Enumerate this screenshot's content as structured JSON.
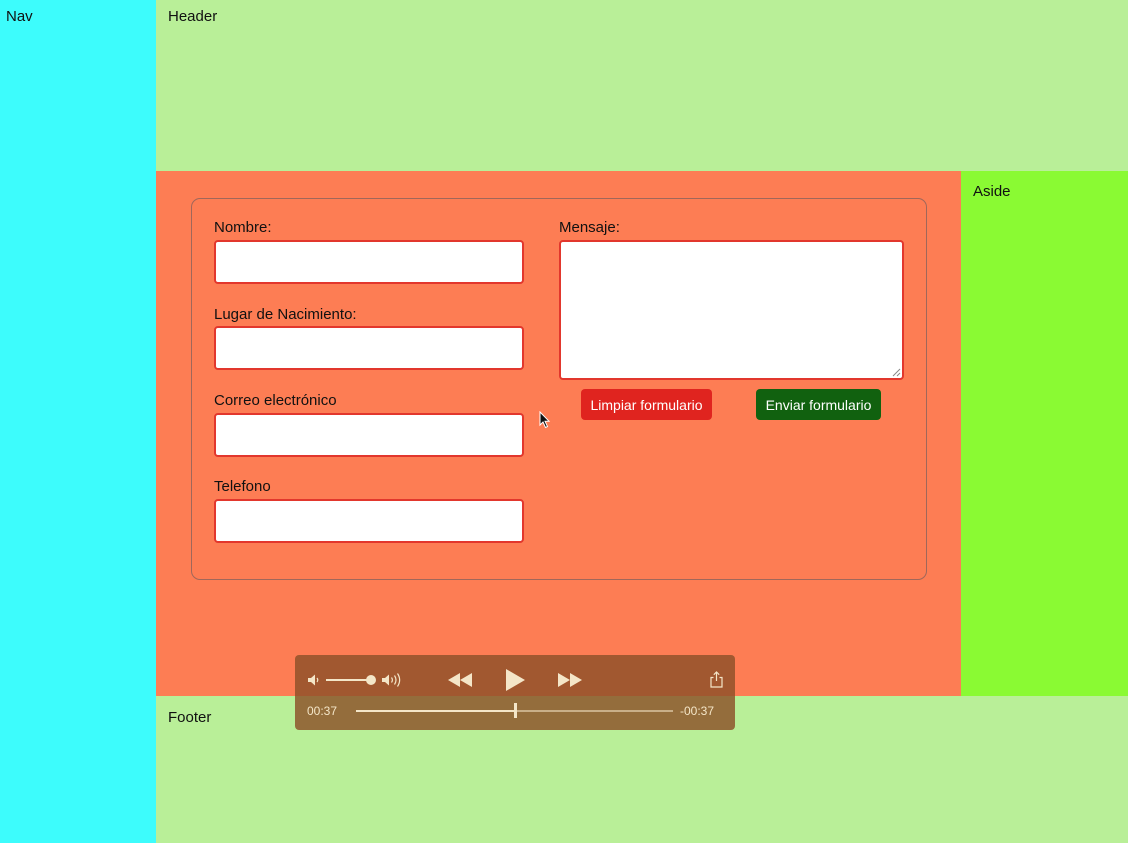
{
  "layout": {
    "nav_label": "Nav",
    "header_label": "Header",
    "aside_label": "Aside",
    "footer_label": "Footer"
  },
  "form": {
    "fields": [
      {
        "label": "Nombre:",
        "value": ""
      },
      {
        "label": "Lugar de Nacimiento:",
        "value": ""
      },
      {
        "label": "Correo electrónico",
        "value": ""
      },
      {
        "label": "Telefono",
        "value": ""
      }
    ],
    "message_label": "Mensaje:",
    "message_value": "",
    "clear_button": "Limpiar formulario",
    "send_button": "Enviar formulario"
  },
  "player": {
    "elapsed": "00:37",
    "remaining": "-00:37",
    "progress": 0.5,
    "volume": 0.9,
    "icons": [
      "volume-low-icon",
      "volume-high-icon",
      "rewind-icon",
      "play-icon",
      "fast-forward-icon",
      "share-icon"
    ]
  },
  "colors": {
    "nav": "#3dfcfc",
    "header": "#b9ef98",
    "main": "#fd7d54",
    "aside": "#8afa33",
    "footer": "#b9ef98",
    "input_border": "#e2372d",
    "clear_button": "#e0241f",
    "send_button": "#11610f"
  }
}
